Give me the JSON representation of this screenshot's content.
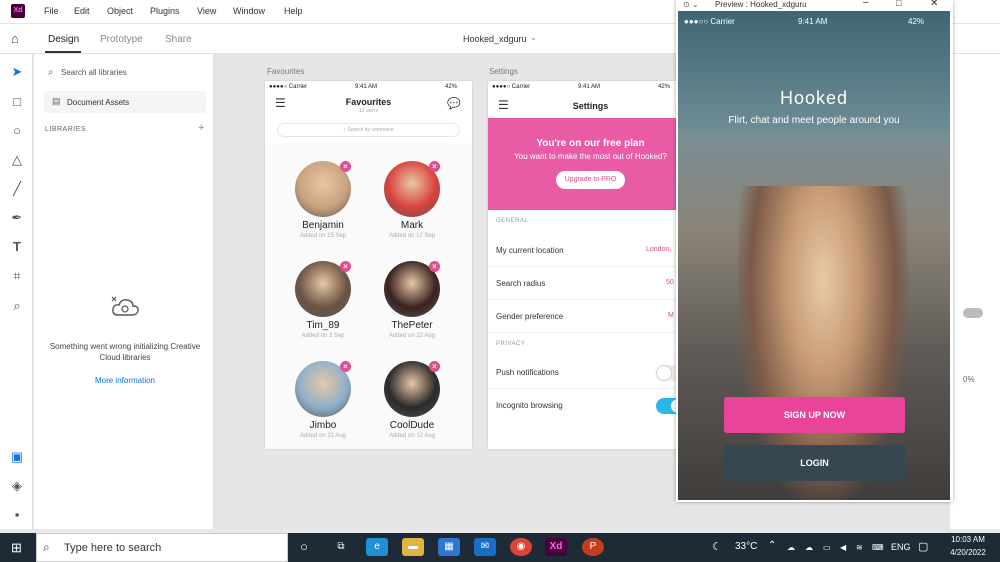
{
  "menubar": {
    "logo": "Xd",
    "items": [
      "File",
      "Edit",
      "Object",
      "Plugins",
      "View",
      "Window",
      "Help"
    ]
  },
  "header": {
    "tabs": [
      "Design",
      "Prototype",
      "Share"
    ],
    "doc_title": "Hooked_xdguru"
  },
  "libraries": {
    "search_placeholder": "Search all libraries",
    "document_assets": "Document Assets",
    "section_label": "LIBRARIES",
    "error_text": "Something went wrong initializing Creative Cloud libraries",
    "more_info": "More information"
  },
  "favourites": {
    "artboard_label": "Favourites",
    "status_carrier": "●●●●○ Carrier",
    "status_time": "9:41 AM",
    "status_battery": "42%",
    "title": "Favourites",
    "subtitle": "12 users",
    "search_placeholder": "Search by username",
    "people": [
      {
        "name": "Benjamin",
        "added": "Added on 15 Sep",
        "color": "#c9a27e"
      },
      {
        "name": "Mark",
        "added": "Added on 12 Sep",
        "color": "#d9423d"
      },
      {
        "name": "Tim_89",
        "added": "Added on 3 Sep",
        "color": "#6b5544"
      },
      {
        "name": "ThePeter",
        "added": "Added on 22 Aug",
        "color": "#3a2320"
      },
      {
        "name": "Jimbo",
        "added": "Added on 21 Aug",
        "color": "#8fb0c9"
      },
      {
        "name": "CoolDude",
        "added": "Added on 12 Aug",
        "color": "#2a2a2a"
      }
    ]
  },
  "settings": {
    "artboard_label": "Settings",
    "status_carrier": "●●●●○ Carrier",
    "status_time": "9:41 AM",
    "status_battery": "42%",
    "title": "Settings",
    "plan_title": "You're on our free plan",
    "plan_subtitle": "You want to make the most out of Hooked?",
    "upgrade_label": "Upgrade to PRO",
    "general_label": "GENERAL",
    "rows": [
      {
        "label": "My current location",
        "value": "London, "
      },
      {
        "label": "Search radius",
        "value": "50"
      },
      {
        "label": "Gender preference",
        "value": "M"
      }
    ],
    "privacy_label": "PRIVACY",
    "privacy_rows": [
      {
        "label": "Push notifications"
      },
      {
        "label": "Incognito browsing"
      }
    ]
  },
  "preview": {
    "window_title": "Preview : Hooked_xdguru",
    "status_carrier": "●●●○○ Carrier",
    "status_time": "9:41 AM",
    "status_battery": "42%",
    "app_name": "Hooked",
    "tagline": "Flirt, chat and meet people around you",
    "signup_label": "SIGN UP NOW",
    "login_label": "LOGIN"
  },
  "right_panel": {
    "percent": "0%"
  },
  "taskbar": {
    "search_placeholder": "Type here to search",
    "temperature": "33°C",
    "language": "ENG",
    "time": "10:03 AM",
    "date": "4/20/2022"
  },
  "colors": {
    "accent_pink": "#e9449a",
    "login_dark": "#37474f",
    "toggle_on": "#29b6e8"
  }
}
